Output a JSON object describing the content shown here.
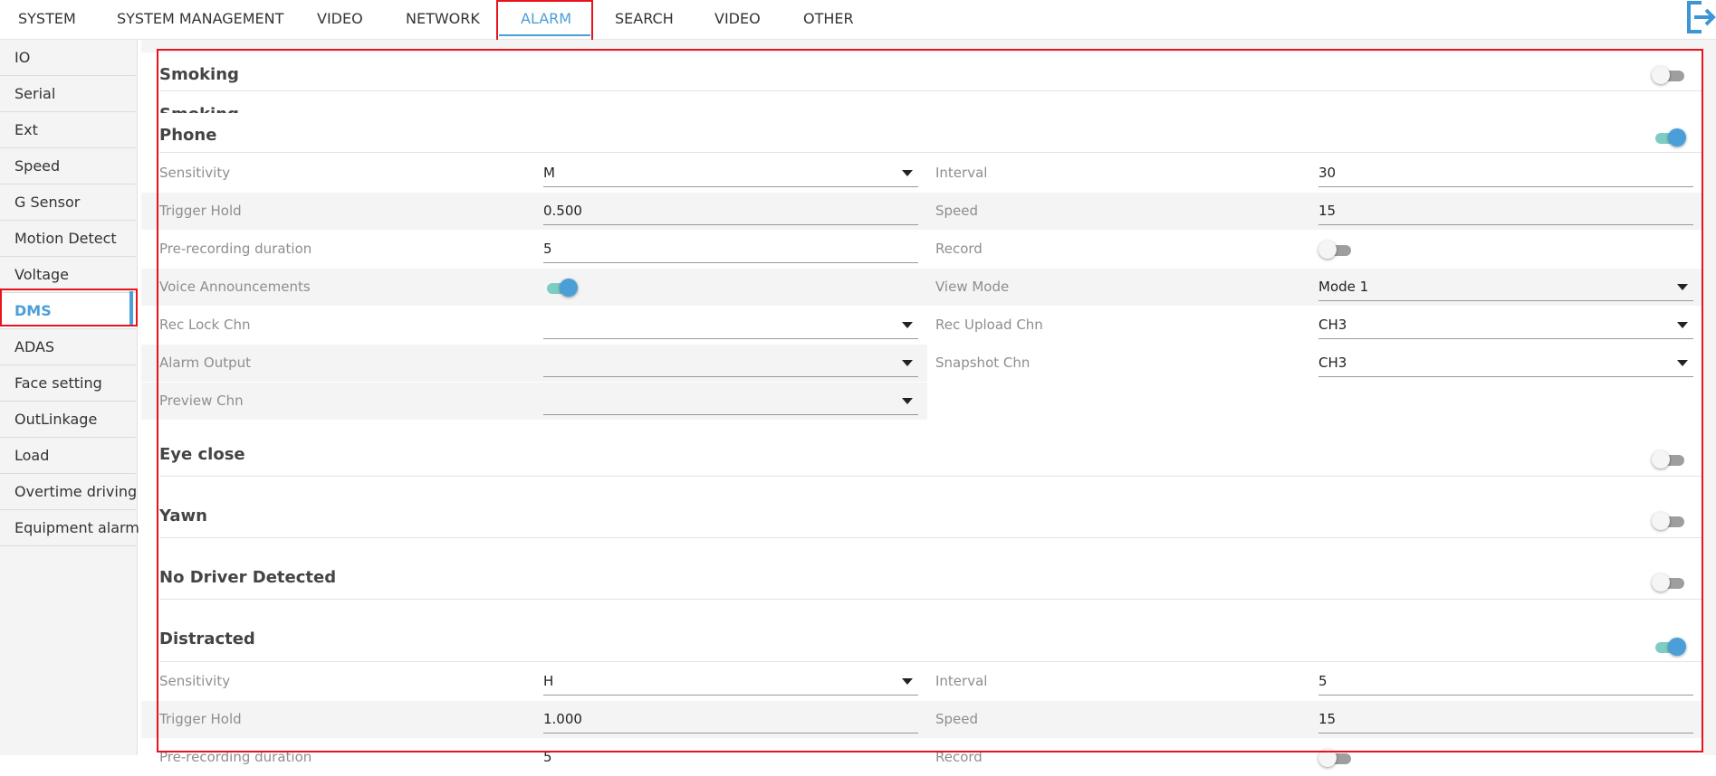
{
  "topnav": {
    "tabs": [
      "SYSTEM",
      "SYSTEM MANAGEMENT",
      "VIDEO",
      "NETWORK",
      "ALARM",
      "SEARCH",
      "VIDEO",
      "OTHER"
    ],
    "active_tab": "ALARM",
    "logout_icon": "logout-icon",
    "accent_color": "#4a9fd8"
  },
  "sidebar": {
    "items": [
      "IO",
      "Serial",
      "Ext",
      "Speed",
      "G Sensor",
      "Motion Detect",
      "Voltage",
      "DMS",
      "ADAS",
      "Face setting",
      "OutLinkage",
      "Load",
      "Overtime driving",
      "Equipment alarm"
    ],
    "active_item": "DMS"
  },
  "highlight_color": "#e8141b",
  "sections": {
    "smoking": {
      "title": "Smoking",
      "enabled": false
    },
    "phone": {
      "title": "Phone",
      "enabled": true,
      "fields": {
        "sensitivity": {
          "label": "Sensitivity",
          "value": "M"
        },
        "interval": {
          "label": "Interval",
          "value": "30"
        },
        "trigger_hold": {
          "label": "Trigger Hold",
          "value": "0.500"
        },
        "speed": {
          "label": "Speed",
          "value": "15"
        },
        "pre_recording": {
          "label": "Pre-recording duration",
          "value": "5"
        },
        "record": {
          "label": "Record",
          "enabled": false
        },
        "voice": {
          "label": "Voice Announcements",
          "enabled": true
        },
        "view_mode": {
          "label": "View Mode",
          "value": "Mode 1"
        },
        "rec_lock": {
          "label": "Rec Lock Chn",
          "value": ""
        },
        "rec_upload": {
          "label": "Rec Upload Chn",
          "value": "CH3"
        },
        "alarm_output": {
          "label": "Alarm Output",
          "value": ""
        },
        "snapshot": {
          "label": "Snapshot Chn",
          "value": "CH3"
        },
        "preview": {
          "label": "Preview Chn",
          "value": ""
        }
      }
    },
    "eye_close": {
      "title": "Eye close",
      "enabled": false
    },
    "yawn": {
      "title": "Yawn",
      "enabled": false
    },
    "no_driver": {
      "title": "No Driver Detected",
      "enabled": false
    },
    "distracted": {
      "title": "Distracted",
      "enabled": true,
      "fields": {
        "sensitivity": {
          "label": "Sensitivity",
          "value": "H"
        },
        "interval": {
          "label": "Interval",
          "value": "5"
        },
        "trigger_hold": {
          "label": "Trigger Hold",
          "value": "1.000"
        },
        "speed": {
          "label": "Speed",
          "value": "15"
        },
        "pre_recording": {
          "label": "Pre-recording duration",
          "value": "5"
        },
        "record": {
          "label": "Record",
          "enabled": false
        }
      }
    }
  }
}
